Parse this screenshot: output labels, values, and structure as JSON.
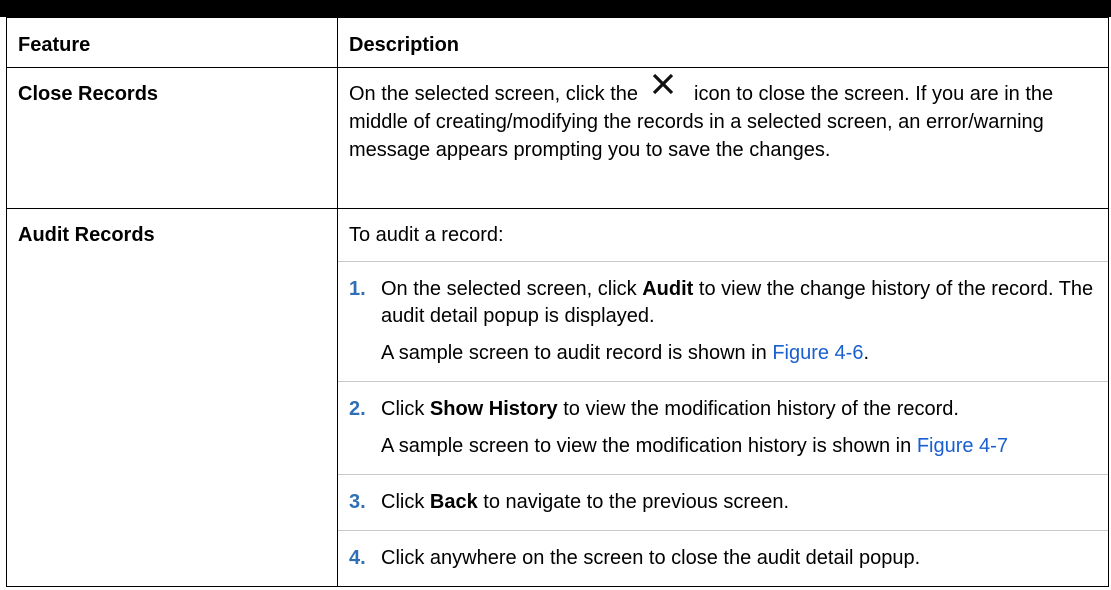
{
  "table": {
    "headers": [
      "Feature",
      "Description"
    ],
    "rows": {
      "close": {
        "feature": "Close Records",
        "desc_before_icon": "On the selected screen, click the",
        "icon": "close-icon",
        "desc_after_icon": "icon to close the screen. If you are in the middle of creating/modifying the records in a selected screen, an error/warning message appears prompting you to save the changes."
      },
      "audit": {
        "feature": "Audit Records",
        "intro": "To audit a record:",
        "steps": [
          {
            "num": "1.",
            "pre": "On the selected screen, click ",
            "bold": "Audit",
            "post": " to view the change history of the record. The audit detail popup is displayed.",
            "note": "A sample screen to audit record is shown in ",
            "link": "Figure 4-6",
            "note_end": "."
          },
          {
            "num": "2.",
            "pre": "Click ",
            "bold": "Show History",
            "post": " to view the modification history of the record.",
            "note": "A sample screen to view the modification history is shown in ",
            "link": "Figure 4-7",
            "note_end": ""
          },
          {
            "num": "3.",
            "pre": "Click ",
            "bold": "Back",
            "post": " to navigate to the previous screen."
          },
          {
            "num": "4.",
            "pre": "Click anywhere on the screen to close the audit detail popup.",
            "bold": "",
            "post": ""
          }
        ]
      }
    }
  },
  "colors": {
    "link": "#1a5fd0",
    "step_number": "#2f6fb6",
    "top_bar": "#000000"
  }
}
